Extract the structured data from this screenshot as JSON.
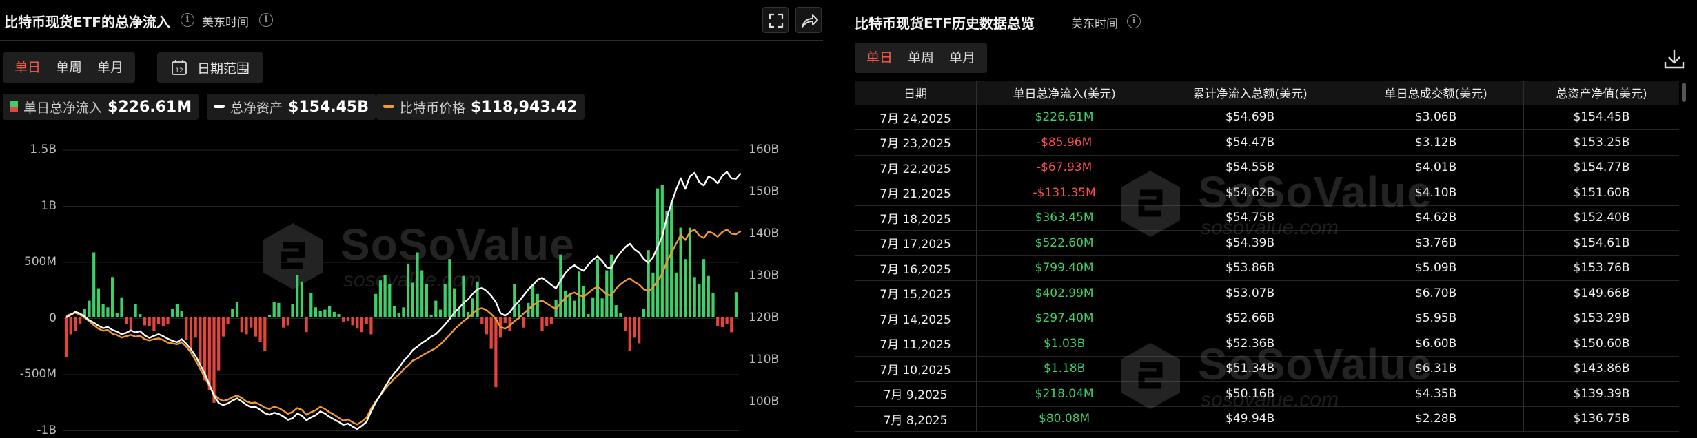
{
  "left": {
    "title": "比特币现货ETF的总净流入",
    "timezone": "美东时间",
    "tabs": [
      "单日",
      "单周",
      "单月"
    ],
    "active_tab": "单日",
    "date_range_label": "日期范围",
    "calendar_icon_text": "12",
    "legend": [
      {
        "label": "单日总净流入",
        "value": "$226.61M"
      },
      {
        "label": "总净资产",
        "value": "$154.45B"
      },
      {
        "label": "比特币价格",
        "value": "$118,943.42"
      }
    ],
    "watermark": {
      "brand": "SoSoValue",
      "domain": "sosovalue.com"
    }
  },
  "chart_data": {
    "type": "bar",
    "title": "比特币现货ETF的总净流入",
    "y_left_ticks": [
      "1.5B",
      "1B",
      "500M",
      "0",
      "-500M",
      "-1B"
    ],
    "y_right_ticks": [
      "160B",
      "150B",
      "140B",
      "130B",
      "120B",
      "110B",
      "100B"
    ],
    "ylim_left": [
      -1000000000,
      1500000000
    ],
    "ylim_right": [
      100000000000,
      160000000000
    ],
    "colors": {
      "inflow": "#3ecf6a",
      "outflow": "#e5443c",
      "net_assets": "#ffffff",
      "btc_price": "#f39a2c"
    },
    "series": [
      {
        "name": "单日总净流入",
        "values": [
          -350,
          -150,
          -120,
          -60,
          80,
          150,
          580,
          260,
          120,
          90,
          360,
          40,
          180,
          -60,
          -120,
          120,
          30,
          -70,
          -80,
          -120,
          -60,
          -80,
          -60,
          80,
          120,
          60,
          -200,
          -300,
          -180,
          -420,
          -560,
          -650,
          -760,
          -470,
          -170,
          -60,
          80,
          140,
          -130,
          -150,
          -90,
          -170,
          -220,
          -300,
          20,
          140,
          130,
          -90,
          -70,
          120,
          380,
          320,
          -130,
          220,
          90,
          60,
          70,
          100,
          50,
          30,
          -40,
          -30,
          -70,
          -100,
          -130,
          -60,
          -150,
          210,
          330,
          380,
          300,
          100,
          40,
          90,
          480,
          310,
          580,
          420,
          300,
          20,
          150,
          70,
          300,
          520,
          260,
          80,
          370,
          50,
          170,
          320,
          -60,
          -150,
          -280,
          -620,
          -180,
          -50,
          -120,
          300,
          120,
          -90,
          130,
          300,
          210,
          -120,
          -80,
          -60,
          160,
          560,
          240,
          210,
          150,
          410,
          280,
          30,
          180,
          520,
          170,
          420,
          560,
          110,
          40,
          -120,
          -300,
          -180,
          -230,
          80,
          600,
          400,
          1150,
          1180,
          950,
          1030,
          400,
          800,
          520,
          800,
          360,
          300,
          520,
          370,
          220,
          -80,
          -85,
          -60,
          -131,
          226
        ]
      },
      {
        "name": "总净资产",
        "values": [
          120.2,
          120.8,
          121.5,
          121.1,
          120.4,
          119.5,
          118.9,
          118.2,
          117.6,
          117.9,
          117.2,
          116.8,
          116.2,
          116.5,
          117.1,
          116.6,
          116.9,
          115.9,
          115.3,
          115.8,
          116.2,
          115.7,
          115.1,
          114.6,
          114.3,
          115.0,
          113.9,
          112.6,
          111.0,
          108.9,
          106.8,
          104.2,
          101.5,
          99.8,
          99.3,
          99.7,
          100.4,
          100.9,
          100.2,
          99.4,
          98.8,
          98.9,
          98.2,
          97.4,
          97.0,
          97.5,
          97.2,
          96.6,
          95.8,
          96.2,
          97.3,
          96.8,
          95.7,
          96.4,
          96.9,
          97.8,
          97.3,
          96.5,
          95.9,
          95.3,
          94.6,
          94.9,
          94.2,
          93.6,
          94.4,
          95.3,
          97.8,
          99.9,
          101.7,
          103.6,
          105.4,
          106.9,
          108.1,
          109.8,
          110.9,
          112.4,
          113.2,
          114.1,
          114.8,
          115.6,
          116.2,
          117.3,
          118.5,
          119.8,
          121.3,
          122.4,
          123.6,
          124.5,
          125.8,
          126.9,
          127.2,
          126.5,
          125.3,
          123.8,
          121.2,
          120.6,
          121.4,
          122.9,
          124.0,
          125.4,
          126.8,
          127.9,
          129.1,
          129.6,
          128.8,
          127.9,
          127.1,
          128.9,
          130.7,
          131.9,
          132.6,
          131.8,
          131.3,
          132.7,
          133.9,
          134.7,
          133.6,
          132.1,
          131.9,
          134.2,
          135.6,
          136.9,
          137.7,
          136.4,
          135.6,
          134.1,
          133.2,
          134.5,
          136.9,
          139.4,
          143.9,
          147.4,
          150.6,
          153.3,
          150.8,
          153.8,
          154.6,
          152.4,
          151.6,
          153.7,
          153.2,
          152.1,
          153.9,
          154.8,
          153.3,
          153.2,
          154.5
        ]
      },
      {
        "name": "比特币价格",
        "values": [
          120.5,
          121.0,
          121.3,
          120.8,
          120.1,
          119.3,
          118.3,
          117.5,
          117.0,
          117.2,
          116.3,
          116.0,
          115.4,
          115.7,
          116.0,
          115.6,
          115.8,
          115.0,
          114.7,
          115.0,
          115.2,
          114.8,
          114.2,
          114.0,
          113.8,
          114.3,
          113.2,
          111.8,
          110.0,
          107.9,
          105.9,
          103.8,
          101.9,
          100.8,
          100.3,
          100.6,
          101.2,
          101.6,
          101.0,
          100.2,
          99.8,
          99.9,
          99.4,
          98.7,
          98.4,
          98.9,
          98.6,
          98.0,
          97.2,
          97.7,
          98.6,
          98.2,
          97.0,
          97.6,
          98.1,
          98.9,
          98.4,
          97.6,
          97.0,
          96.3,
          95.6,
          95.9,
          95.2,
          94.7,
          95.4,
          96.3,
          98.5,
          100.2,
          101.6,
          103.1,
          104.4,
          105.6,
          106.5,
          107.8,
          108.7,
          109.9,
          110.4,
          111.1,
          111.7,
          112.3,
          112.9,
          113.8,
          114.9,
          116.0,
          117.3,
          118.3,
          119.3,
          120.1,
          121.2,
          122.1,
          122.4,
          121.9,
          121.0,
          119.8,
          117.9,
          117.5,
          118.2,
          119.3,
          120.0,
          121.1,
          122.1,
          123.0,
          123.8,
          124.2,
          123.5,
          122.8,
          122.2,
          123.5,
          124.8,
          125.7,
          126.1,
          125.5,
          125.1,
          126.0,
          126.9,
          127.5,
          126.7,
          125.6,
          125.4,
          127.0,
          128.1,
          128.9,
          129.5,
          128.6,
          128.0,
          126.9,
          126.4,
          127.3,
          128.9,
          130.6,
          133.4,
          135.6,
          137.7,
          139.8,
          138.6,
          140.5,
          141.1,
          139.7,
          139.1,
          140.6,
          140.2,
          139.4,
          140.5,
          141.1,
          140.1,
          140.0,
          140.7
        ]
      }
    ]
  },
  "right": {
    "title": "比特币现货ETF历史数据总览",
    "timezone": "美东时间",
    "tabs": [
      "单日",
      "单周",
      "单月"
    ],
    "active_tab": "单日",
    "columns": [
      "日期",
      "单日总净流入(美元)",
      "累计净流入总额(美元)",
      "单日总成交额(美元)",
      "总资产净值(美元)"
    ],
    "rows": [
      {
        "date": "7月 24,2025",
        "flow": "$226.61M",
        "sign": "pos",
        "cum": "$54.69B",
        "vol": "$3.06B",
        "nav": "$154.45B"
      },
      {
        "date": "7月 23,2025",
        "flow": "-$85.96M",
        "sign": "neg",
        "cum": "$54.47B",
        "vol": "$3.12B",
        "nav": "$153.25B"
      },
      {
        "date": "7月 22,2025",
        "flow": "-$67.93M",
        "sign": "neg",
        "cum": "$54.55B",
        "vol": "$4.01B",
        "nav": "$154.77B"
      },
      {
        "date": "7月 21,2025",
        "flow": "-$131.35M",
        "sign": "neg",
        "cum": "$54.62B",
        "vol": "$4.10B",
        "nav": "$151.60B"
      },
      {
        "date": "7月 18,2025",
        "flow": "$363.45M",
        "sign": "pos",
        "cum": "$54.75B",
        "vol": "$4.62B",
        "nav": "$152.40B"
      },
      {
        "date": "7月 17,2025",
        "flow": "$522.60M",
        "sign": "pos",
        "cum": "$54.39B",
        "vol": "$3.76B",
        "nav": "$154.61B"
      },
      {
        "date": "7月 16,2025",
        "flow": "$799.40M",
        "sign": "pos",
        "cum": "$53.86B",
        "vol": "$5.09B",
        "nav": "$153.76B"
      },
      {
        "date": "7月 15,2025",
        "flow": "$402.99M",
        "sign": "pos",
        "cum": "$53.07B",
        "vol": "$6.70B",
        "nav": "$149.66B"
      },
      {
        "date": "7月 14,2025",
        "flow": "$297.40M",
        "sign": "pos",
        "cum": "$52.66B",
        "vol": "$5.95B",
        "nav": "$153.29B"
      },
      {
        "date": "7月 11,2025",
        "flow": "$1.03B",
        "sign": "pos",
        "cum": "$52.36B",
        "vol": "$6.60B",
        "nav": "$150.60B"
      },
      {
        "date": "7月 10,2025",
        "flow": "$1.18B",
        "sign": "pos",
        "cum": "$51.34B",
        "vol": "$6.31B",
        "nav": "$143.86B"
      },
      {
        "date": "7月 9,2025",
        "flow": "$218.04M",
        "sign": "pos",
        "cum": "$50.16B",
        "vol": "$4.35B",
        "nav": "$139.39B"
      },
      {
        "date": "7月 8,2025",
        "flow": "$80.08M",
        "sign": "pos",
        "cum": "$49.94B",
        "vol": "$2.28B",
        "nav": "$136.75B"
      }
    ],
    "watermark": {
      "brand": "SoSoValue",
      "domain": "sosovalue.com"
    }
  }
}
